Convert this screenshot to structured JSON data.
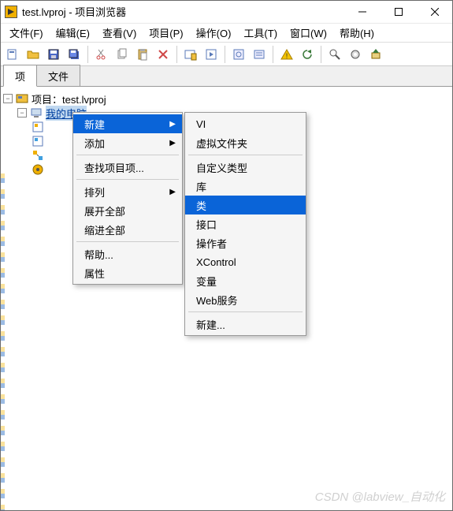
{
  "window": {
    "title": "test.lvproj - 项目浏览器"
  },
  "menu": {
    "file": "文件(F)",
    "edit": "编辑(E)",
    "view": "查看(V)",
    "project": "项目(P)",
    "operate": "操作(O)",
    "tools": "工具(T)",
    "window": "窗口(W)",
    "help": "帮助(H)"
  },
  "tabs": {
    "items": "项",
    "files": "文件"
  },
  "tree": {
    "root": "项目：test.lvproj",
    "my_computer": "我的电脑"
  },
  "context_menu": {
    "new": "新建",
    "add": "添加",
    "find_project_items": "查找项目项...",
    "arrange": "排列",
    "expand_all": "展开全部",
    "collapse_all": "缩进全部",
    "help": "帮助...",
    "properties": "属性"
  },
  "submenu": {
    "vi": "VI",
    "virtual_folder": "虚拟文件夹",
    "custom_type": "自定义类型",
    "library": "库",
    "class": "类",
    "interface": "接口",
    "actor": "操作者",
    "xcontrol": "XControl",
    "variable": "变量",
    "web_service": "Web服务",
    "new_more": "新建..."
  },
  "watermark": "CSDN @labview_自动化"
}
